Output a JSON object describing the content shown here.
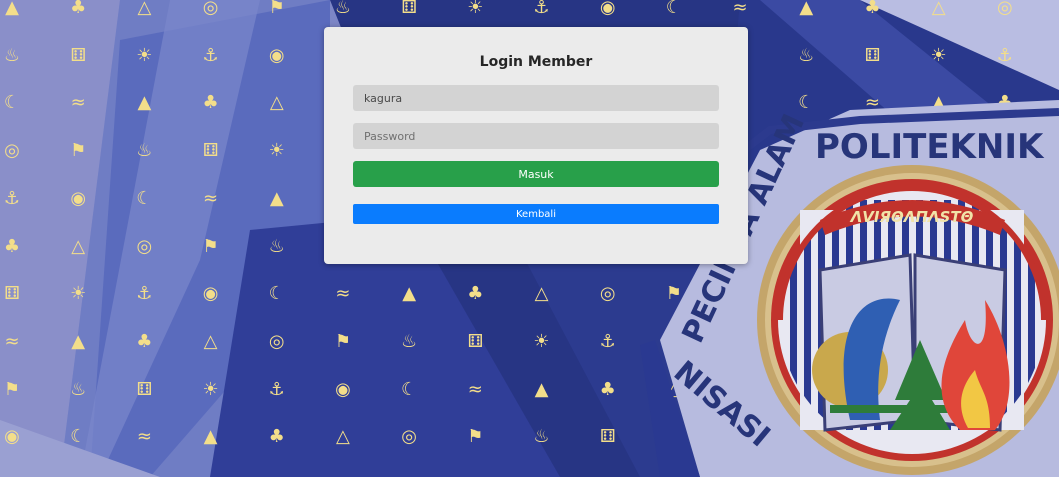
{
  "login": {
    "title": "Login Member",
    "username_value": "kagura",
    "password_placeholder": "Password",
    "submit_label": "Masuk",
    "back_label": "Kembali"
  },
  "emblem": {
    "top_text": "POLITEKNIK",
    "script_text": "ΛVIЯΘΛΠΛЅΤΘ",
    "arc_left_text": "PECINTA ALAM",
    "arc_bottom_text": "NISASI"
  },
  "background": {
    "icon_color": "#f3de8a",
    "icon_names": [
      "mountain-icon",
      "trees-icon",
      "tent-icon",
      "compass-icon",
      "hiker-icon",
      "campfire-icon",
      "bicycle-icon",
      "sun-icon",
      "boat-icon",
      "binoculars-icon",
      "moon-icon",
      "swim-icon"
    ]
  },
  "colors": {
    "success": "#28a04a",
    "primary": "#0a7cfe",
    "card": "#ebebeb",
    "input": "#d3d3d3"
  }
}
